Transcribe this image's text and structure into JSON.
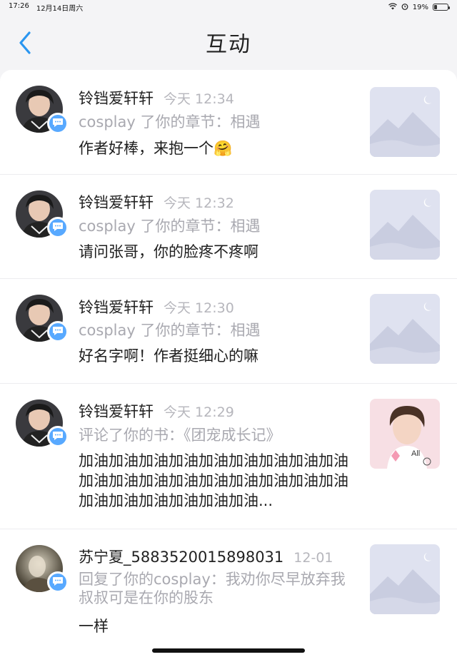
{
  "status": {
    "time": "17:26",
    "date": "12月14日周六",
    "battery": "19%"
  },
  "header": {
    "title": "互动"
  },
  "items": [
    {
      "name": "铃铛爱轩轩",
      "time": "今天 12:34",
      "action": "cosplay 了你的章节：相遇",
      "content": "作者好棒，来抱一个🤗"
    },
    {
      "name": "铃铛爱轩轩",
      "time": "今天 12:32",
      "action": "cosplay 了你的章节：相遇",
      "content": "请问张哥，你的脸疼不疼啊"
    },
    {
      "name": "铃铛爱轩轩",
      "time": "今天 12:30",
      "action": "cosplay 了你的章节：相遇",
      "content": "好名字啊！作者挺细心的嘛"
    },
    {
      "name": "铃铛爱轩轩",
      "time": "今天 12:29",
      "action": "评论了你的书：《团宠成长记》",
      "content": "加油加油加油加油加油加油加油加油加油加油加油加油加油加油加油加油加油加油加油加油加油加油加油加油..."
    },
    {
      "name": "苏宁夏_5883520015898031",
      "time": "12-01",
      "action": "回复了你的cosplay：我劝你尽早放弃我叔叔可是在你的股东",
      "content": "一样"
    }
  ],
  "colors": {
    "accent": "#58a9ff",
    "back": "#2a96f0"
  }
}
